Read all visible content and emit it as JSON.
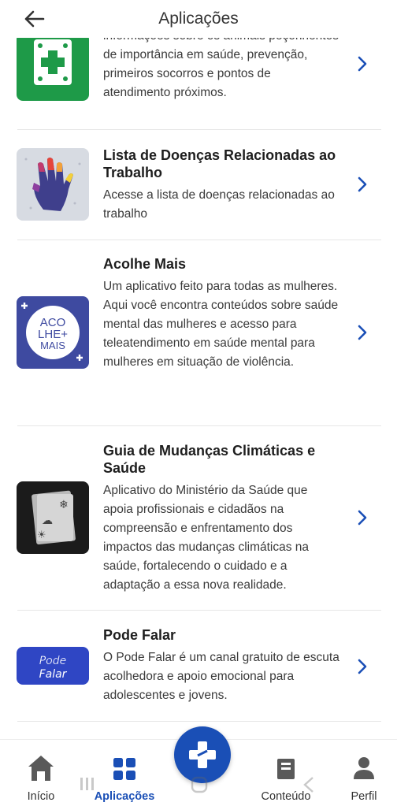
{
  "header": {
    "title": "Aplicações"
  },
  "items": [
    {
      "title": "",
      "description": "informações sobre os animais peçonhentos de importância em saúde, prevenção, primeiros socorros e pontos de atendimento próximos."
    },
    {
      "title": "Lista de Doenças Relacionadas ao Trabalho",
      "description": "Acesse a lista de doenças relacionadas ao trabalho"
    },
    {
      "title": "Acolhe Mais",
      "description": "Um aplicativo feito para todas as mulheres. Aqui você encontra conteúdos sobre saúde mental das mulheres e acesso para teleatendimento em saúde mental para mulheres em situação de violência.",
      "logo_text": "ACO\nLHE+\nMAIS"
    },
    {
      "title": "Guia de Mudanças Climáticas e Saúde",
      "description": "Aplicativo do Ministério da Saúde que apoia profissionais e cidadãos na compreensão e enfrentamento dos impactos das mudanças climáticas na saúde, fortalecendo o cuidado e a adaptação a essa nova realidade."
    },
    {
      "title": "Pode Falar",
      "description": "O Pode Falar é um canal gratuito de escuta acolhedora e apoio emocional para adolescentes e jovens.",
      "logo_text": "Pode Falar"
    }
  ],
  "bottom_nav": {
    "inicio": "Início",
    "aplicacoes": "Aplicações",
    "conteudo": "Conteúdo",
    "perfil": "Perfil"
  },
  "colors": {
    "primary": "#1a4fb6",
    "green": "#1e9a48",
    "acolhe": "#3e4aa0"
  }
}
